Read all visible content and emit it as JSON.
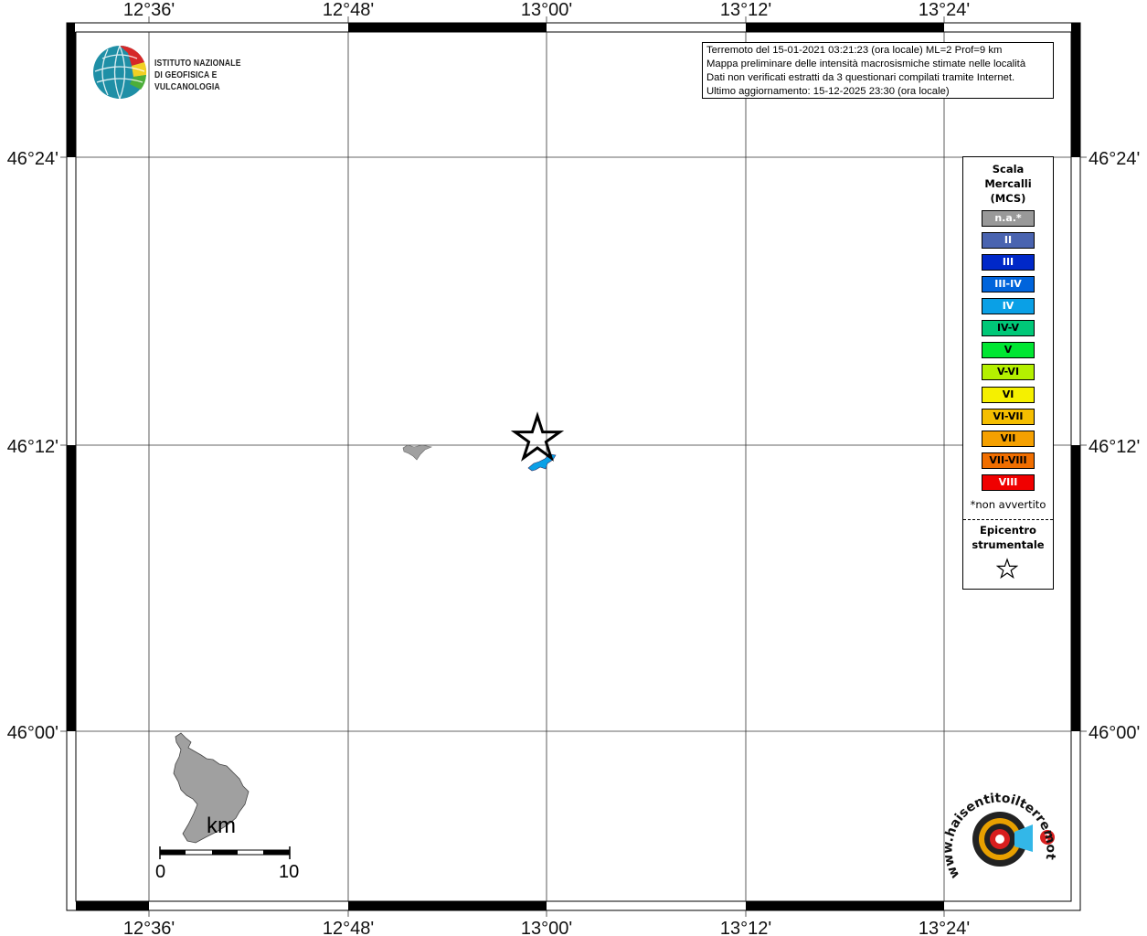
{
  "map": {
    "lon_ticks_top": [
      "12°36'",
      "12°48'",
      "13°00'",
      "13°12'",
      "13°24'"
    ],
    "lon_ticks_bottom": [
      "12°36'",
      "12°48'",
      "13°00'",
      "13°12'",
      "13°24'"
    ],
    "lat_ticks_left": [
      "46°24'",
      "46°12'",
      "46°00'"
    ],
    "lat_ticks_right": [
      "46°24'",
      "46°12'",
      "46°00'"
    ],
    "land_color": "#a0a0a0",
    "intensity_area_color": "#0099dd"
  },
  "info_box": {
    "line1": "Terremoto del 15-01-2021 03:21:23 (ora locale) ML=2 Prof=9 km",
    "line2": "Mappa preliminare delle intensità macrosismiche stimate nelle località",
    "line3": "Dati non verificati estratti da 3 questionari compilati tramite Internet.",
    "line4": "Ultimo aggiornamento: 15-12-2025 23:30 (ora locale)"
  },
  "logo": {
    "line1": "ISTITUTO NAZIONALE",
    "line2": "DI GEOFISICA E VULCANOLOGIA",
    "icon": "ingv-globe-icon"
  },
  "legend": {
    "title1": "Scala",
    "title2": "Mercalli",
    "title3": "(MCS)",
    "levels": [
      {
        "label": "n.a.*",
        "color": "#999999",
        "text_color": "#ffffff"
      },
      {
        "label": "II",
        "color": "#4a64b0",
        "text_color": "#ffffff"
      },
      {
        "label": "III",
        "color": "#0028c8",
        "text_color": "#ffffff"
      },
      {
        "label": "III-IV",
        "color": "#0064dc",
        "text_color": "#ffffff"
      },
      {
        "label": "IV",
        "color": "#0aa0e6",
        "text_color": "#ffffff"
      },
      {
        "label": "IV-V",
        "color": "#00c878",
        "text_color": "#000000"
      },
      {
        "label": "V",
        "color": "#00e632",
        "text_color": "#000000"
      },
      {
        "label": "V-VI",
        "color": "#b4f000",
        "text_color": "#000000"
      },
      {
        "label": "VI",
        "color": "#f5f000",
        "text_color": "#000000"
      },
      {
        "label": "VI-VII",
        "color": "#f5be00",
        "text_color": "#000000"
      },
      {
        "label": "VII",
        "color": "#f5a000",
        "text_color": "#000000"
      },
      {
        "label": "VII-VIII",
        "color": "#f06e00",
        "text_color": "#000000"
      },
      {
        "label": "VIII",
        "color": "#f00000",
        "text_color": "#ffffff"
      }
    ],
    "note": "*non avvertito",
    "epicenter1": "Epicentro",
    "epicenter2": "strumentale",
    "epicenter_icon": "star-icon"
  },
  "scale_bar": {
    "unit": "km",
    "start": "0",
    "end": "10"
  },
  "badge": {
    "text": "www.haisentitoilterremoto.it",
    "icon": "hai-sentito-il-terremoto-icon"
  }
}
